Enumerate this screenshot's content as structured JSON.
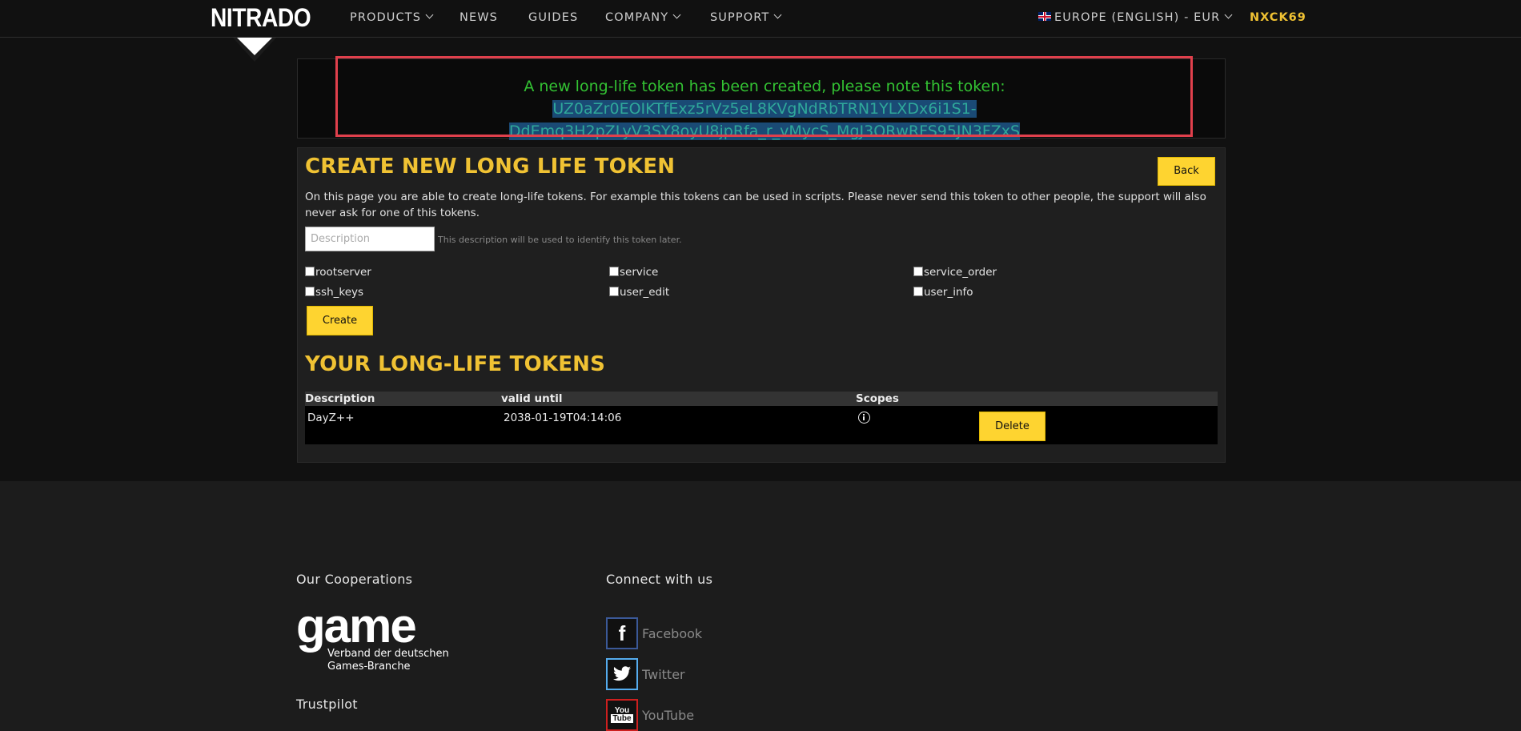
{
  "nav": {
    "logo": "NITRADO",
    "items": [
      {
        "label": "PRODUCTS",
        "dropdown": true
      },
      {
        "label": "NEWS",
        "dropdown": false
      },
      {
        "label": "GUIDES",
        "dropdown": false
      },
      {
        "label": "COMPANY",
        "dropdown": true
      },
      {
        "label": "SUPPORT",
        "dropdown": true
      }
    ],
    "region": "EUROPE (ENGLISH) - EUR",
    "user": "NXCK69"
  },
  "notice": {
    "message": "A new long-life token has been created, please note this token:",
    "token_part1": "UZ0aZr0EOIKTfExz5rVz5eL8KVgNdRbTRN1YLXDx6i1S1-",
    "token_part2": "DdEmq3H2pZLyV3SY8oyU8jpRfa_r_vMycS_MgJ3ORwRFS95JN3FZxS"
  },
  "create": {
    "title": "CREATE NEW LONG LIFE TOKEN",
    "back_label": "Back",
    "description": "On this page you are able to create long-life tokens. For example this tokens can be used in scripts. Please never send this token to other people, the support will also never ask for one of this tokens.",
    "input_placeholder": "Description",
    "input_hint": "This description will be used to identify this token later.",
    "scopes": [
      "rootserver",
      "service",
      "service_order",
      "ssh_keys",
      "user_edit",
      "user_info"
    ],
    "create_label": "Create"
  },
  "tokens": {
    "title": "YOUR LONG-LIFE TOKENS",
    "headers": [
      "Description",
      "valid until",
      "Scopes"
    ],
    "rows": [
      {
        "description": "DayZ++",
        "valid_until": "2038-01-19T04:14:06",
        "delete_label": "Delete"
      }
    ]
  },
  "footer": {
    "cooperations_title": "Our Cooperations",
    "game_logo": "game",
    "game_sub_line1": "Verband der deutschen",
    "game_sub_line2": "Games-Branche",
    "trustpilot": "Trustpilot",
    "connect_title": "Connect with us",
    "social": [
      {
        "name": "Facebook",
        "icon": "facebook-icon",
        "color": "#3b5998"
      },
      {
        "name": "Twitter",
        "icon": "twitter-icon",
        "color": "#55acee"
      },
      {
        "name": "YouTube",
        "icon": "youtube-icon",
        "color": "#cd201f"
      }
    ]
  },
  "colors": {
    "accent": "#f0c233",
    "button": "#fed430",
    "success_text": "#33c233",
    "highlight_border": "#e0404c"
  }
}
